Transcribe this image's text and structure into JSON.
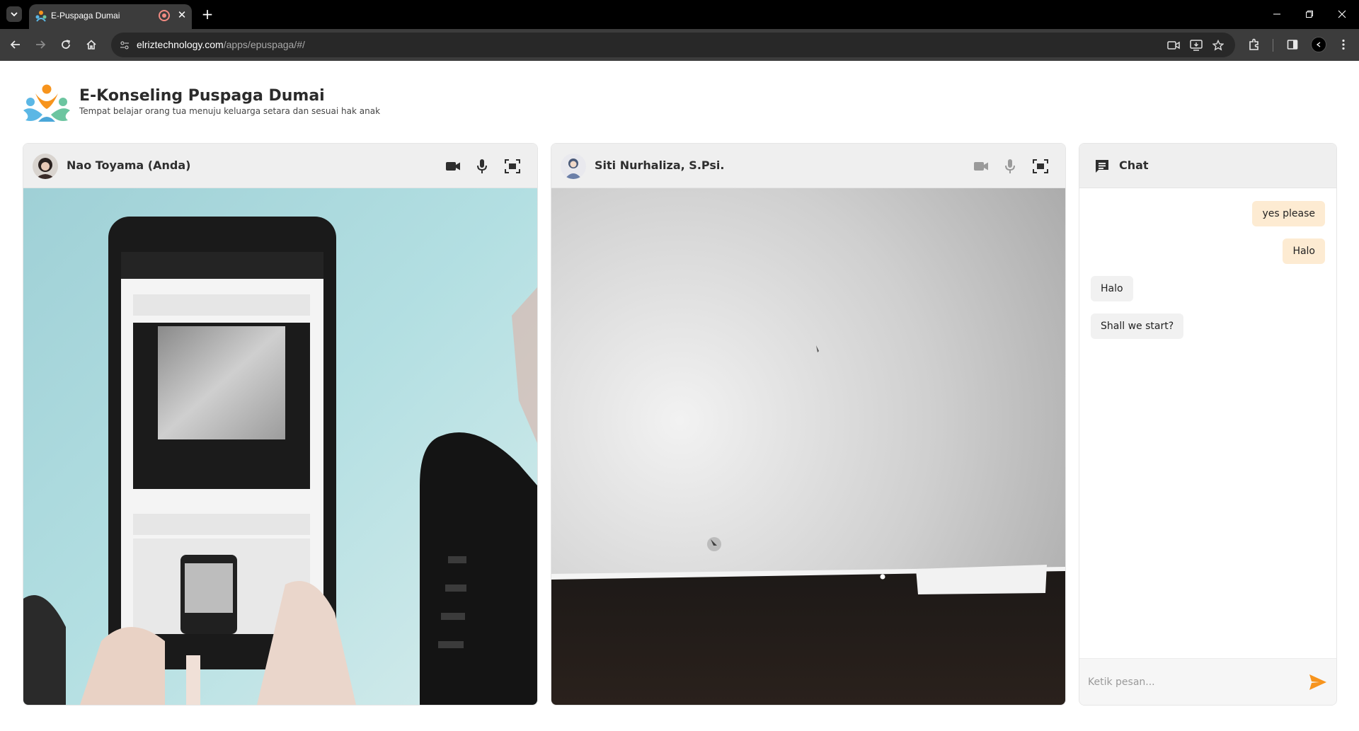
{
  "browser": {
    "tab_title": "E-Puspaga Dumai",
    "url_host": "elriztechnology.com",
    "url_path": "/apps/epuspaga/#/",
    "icons": [
      "tab-search-icon",
      "recording-icon",
      "close-icon",
      "plus-icon",
      "minimize-icon",
      "restore-icon",
      "close-window-icon",
      "back-icon",
      "forward-icon",
      "reload-icon",
      "home-icon",
      "site-settings-icon",
      "camera-in-use-icon",
      "install-app-icon",
      "bookmark-star-icon",
      "extensions-icon",
      "side-panel-icon",
      "profile-icon",
      "menu-icon"
    ]
  },
  "header": {
    "title": "E-Konseling Puspaga Dumai",
    "subtitle": "Tempat belajar orang tua menuju keluarga setara dan sesuai hak anak"
  },
  "local_panel": {
    "name": "Nao Toyama (Anda)",
    "icons": [
      "video-camera-icon",
      "microphone-icon",
      "fullscreen-icon"
    ]
  },
  "remote_panel": {
    "name": "Siti Nurhaliza, S.Psi.",
    "icons": [
      "video-camera-icon",
      "microphone-icon",
      "fullscreen-icon"
    ]
  },
  "chat": {
    "title": "Chat",
    "messages": [
      {
        "text": "yes please",
        "from": "me"
      },
      {
        "text": "Halo",
        "from": "me"
      },
      {
        "text": "Halo",
        "from": "other"
      },
      {
        "text": "Shall we start?",
        "from": "other"
      }
    ],
    "input_placeholder": "Ketik pesan...",
    "input_value": "",
    "icons": [
      "chat-bubble-icon",
      "send-icon"
    ]
  },
  "colors": {
    "accent_orange": "#f7941d",
    "bubble_out": "#fdebd2",
    "bubble_in": "#f1f1f1",
    "panel_header": "#efefef",
    "chrome_dark": "#3c3c3c"
  }
}
